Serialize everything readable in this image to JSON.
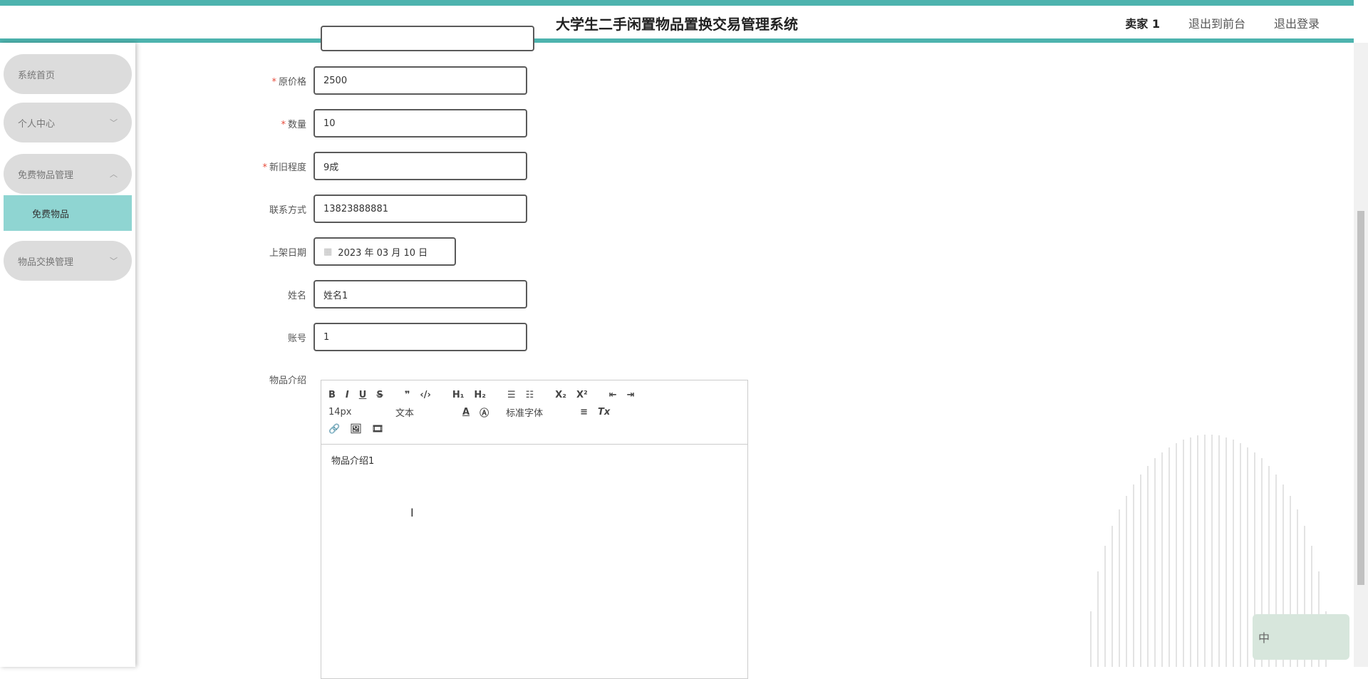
{
  "header": {
    "title": "大学生二手闲置物品置换交易管理系统",
    "user": "卖家 1",
    "to_front": "退出到前台",
    "logout": "退出登录"
  },
  "sidebar": {
    "items": [
      {
        "label": "系统首页",
        "chevron": ""
      },
      {
        "label": "个人中心",
        "chevron": "﹀"
      },
      {
        "label": "免费物品管理",
        "chevron": "︿"
      },
      {
        "label": "物品交换管理",
        "chevron": "﹀"
      }
    ],
    "submenu_active": "免费物品"
  },
  "form": {
    "original_price": {
      "label": "原价格",
      "value": "2500"
    },
    "quantity": {
      "label": "数量",
      "value": "10"
    },
    "condition": {
      "label": "新旧程度",
      "value": "9成"
    },
    "contact": {
      "label": "联系方式",
      "value": "13823888881"
    },
    "list_date": {
      "label": "上架日期",
      "value": "2023 年 03 月 10 日"
    },
    "name": {
      "label": "姓名",
      "value": "姓名1"
    },
    "account": {
      "label": "账号",
      "value": "1"
    },
    "description": {
      "label": "物品介绍",
      "value": "物品介绍1"
    }
  },
  "editor": {
    "font_size": "14px",
    "block_type": "文本",
    "font_family": "标准字体"
  },
  "corner_widget": {
    "label": "中"
  }
}
